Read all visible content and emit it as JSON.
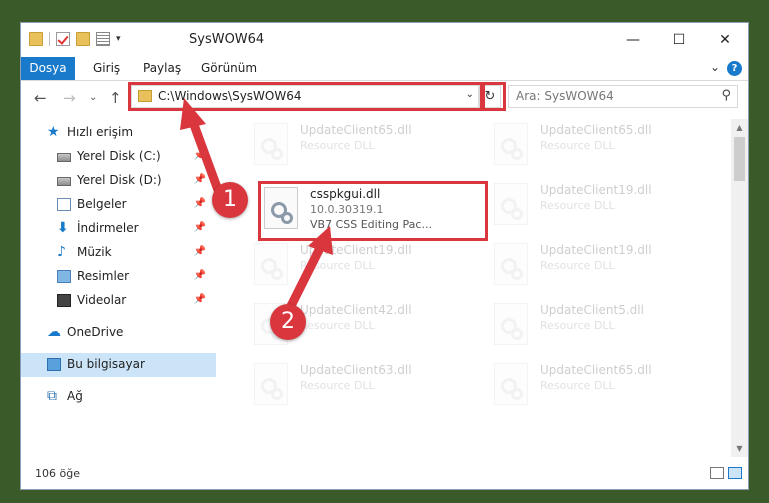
{
  "window": {
    "title": "SysWOW64",
    "minimize_glyph": "—",
    "maximize_glyph": "☐",
    "close_glyph": "✕"
  },
  "ribbon": {
    "tabs": [
      {
        "label": "Dosya",
        "active": true
      },
      {
        "label": "Giriş"
      },
      {
        "label": "Paylaş"
      },
      {
        "label": "Görünüm"
      }
    ],
    "expand_glyph": "⌄",
    "help_glyph": "?"
  },
  "nav": {
    "back_glyph": "←",
    "forward_glyph": "→",
    "recent_glyph": "⌄",
    "up_glyph": "↑",
    "address": "C:\\Windows\\SysWOW64",
    "address_dropdown_glyph": "⌄",
    "refresh_glyph": "↻",
    "search_placeholder": "Ara: SysWOW64",
    "search_glyph": "⚲"
  },
  "sidebar": {
    "items": [
      {
        "label": "Hızlı erişim",
        "icon": "star-icon",
        "glyph": "★"
      },
      {
        "label": "Yerel Disk (C:)",
        "icon": "disk-icon",
        "pinned": true
      },
      {
        "label": "Yerel Disk (D:)",
        "icon": "disk-icon",
        "pinned": true
      },
      {
        "label": "Belgeler",
        "icon": "document-icon",
        "pinned": true
      },
      {
        "label": "İndirmeler",
        "icon": "download-icon",
        "glyph": "⬇",
        "pinned": true
      },
      {
        "label": "Müzik",
        "icon": "music-icon",
        "glyph": "♪",
        "pinned": true
      },
      {
        "label": "Resimler",
        "icon": "pictures-icon",
        "pinned": true
      },
      {
        "label": "Videolar",
        "icon": "videos-icon",
        "pinned": true
      },
      {
        "label": "OneDrive",
        "icon": "cloud-icon",
        "glyph": "☁"
      },
      {
        "label": "Bu bilgisayar",
        "icon": "computer-icon",
        "selected": true
      },
      {
        "label": "Ağ",
        "icon": "network-icon",
        "glyph": "⧉"
      }
    ],
    "pin_glyph": "📌"
  },
  "files": {
    "main": {
      "name": "csspkgui.dll",
      "version": "10.0.30319.1",
      "description": "VB7 CSS Editing Pac..."
    },
    "faded": [
      {
        "name": "UpdateClient65.dll",
        "type": "Resource DLL"
      },
      {
        "name": "UpdateClient65.dll",
        "type": "Resource DLL"
      },
      {
        "name": "UpdateClient19.dll",
        "type": "Resource DLL"
      },
      {
        "name": "UpdateClient19.dll",
        "type": "Resource DLL"
      },
      {
        "name": "UpdateClient19.dll",
        "type": "Resource DLL"
      },
      {
        "name": "UpdateClient42.dll",
        "type": "Resource DLL"
      },
      {
        "name": "UpdateClient5.dll",
        "type": "Resource DLL"
      },
      {
        "name": "UpdateClient63.dll",
        "type": "Resource DLL"
      },
      {
        "name": "UpdateClient65.dll",
        "type": "Resource DLL"
      }
    ]
  },
  "status": {
    "count": "106 öğe"
  },
  "annotations": {
    "step1": "1",
    "step2": "2",
    "color": "#d9363e"
  }
}
